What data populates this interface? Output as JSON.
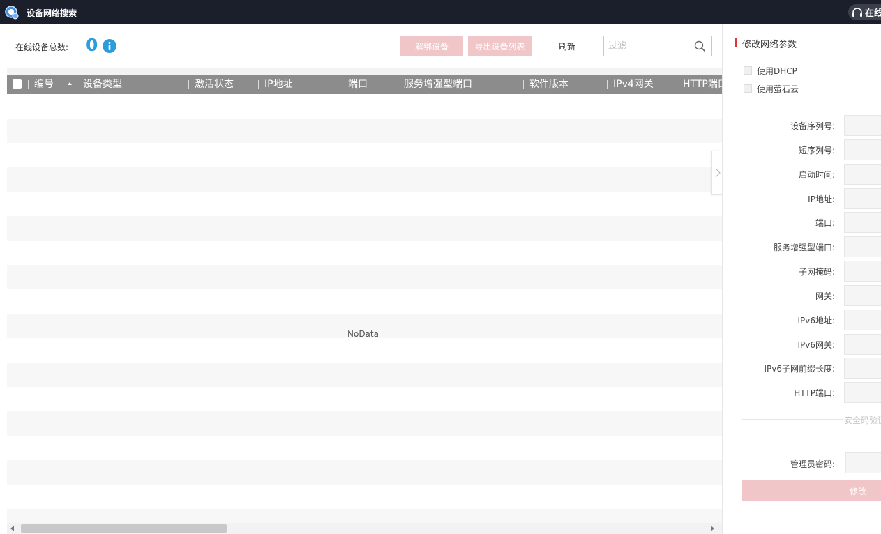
{
  "app": {
    "title": "设备网络搜索",
    "online_label": "在线"
  },
  "toolbar": {
    "count_label": "在线设备总数:",
    "count_value": "0",
    "unbind_label": "解绑设备",
    "export_label": "导出设备列表",
    "refresh_label": "刷新",
    "filter_placeholder": "过滤"
  },
  "table": {
    "columns": [
      "编号",
      "设备类型",
      "激活状态",
      "IP地址",
      "端口",
      "服务增强型端口",
      "软件版本",
      "IPv4网关",
      "HTTP端口"
    ],
    "empty_text": "NoData"
  },
  "panel": {
    "title": "修改网络参数",
    "use_dhcp": "使用DHCP",
    "use_ezviz": "使用萤石云",
    "fields": [
      {
        "label": "设备序列号:"
      },
      {
        "label": "短序列号:"
      },
      {
        "label": "启动时间:"
      },
      {
        "label": "IP地址:"
      },
      {
        "label": "端口:"
      },
      {
        "label": "服务增强型端口:"
      },
      {
        "label": "子网掩码:"
      },
      {
        "label": "网关:"
      },
      {
        "label": "IPv6地址:"
      },
      {
        "label": "IPv6网关:"
      },
      {
        "label": "IPv6子网前缀长度:"
      },
      {
        "label": "HTTP端口:"
      }
    ],
    "security_divider": "安全码验证",
    "admin_password_label": "管理员密码:",
    "modify_label": "修改"
  },
  "colors": {
    "accent_blue": "#2d9cdb",
    "disabled_red": "#f0c6c8",
    "marker_red": "#e0333a",
    "titlebar": "#1a1f2b",
    "table_header": "#8c8c8c"
  }
}
